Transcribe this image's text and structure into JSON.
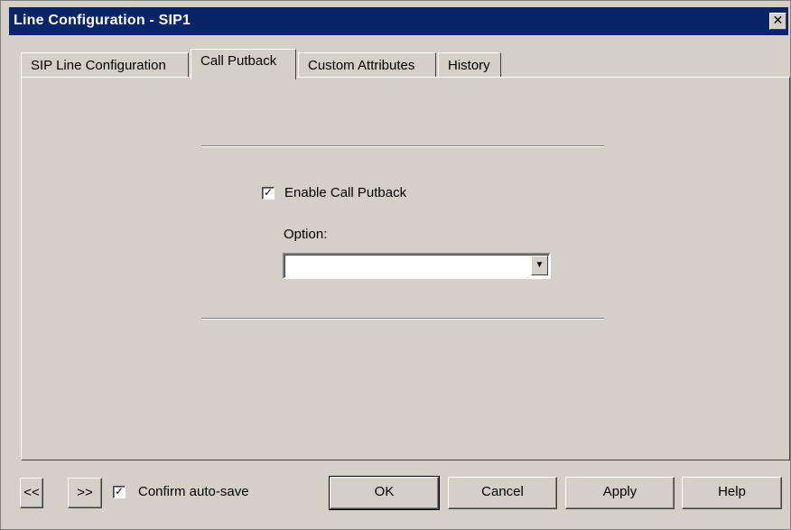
{
  "window": {
    "title": "Line Configuration - SIP1",
    "close_glyph": "✕"
  },
  "tabs": [
    {
      "label": "SIP Line Configuration",
      "active": false
    },
    {
      "label": "Call Putback",
      "active": true
    },
    {
      "label": "Custom Attributes",
      "active": false
    },
    {
      "label": "History",
      "active": false
    }
  ],
  "call_putback": {
    "enable_label": "Enable Call Putback",
    "enable_checked": true,
    "option_label": "Option:",
    "option_value": ""
  },
  "footer": {
    "prev_label": "<<",
    "next_label": ">>",
    "confirm_label": "Confirm auto-save",
    "confirm_checked": true,
    "ok_label": "OK",
    "cancel_label": "Cancel",
    "apply_label": "Apply",
    "help_label": "Help"
  },
  "icons": {
    "check": "✓",
    "dropdown_arrow": "▼"
  },
  "colors": {
    "titlebar": "#0a246a",
    "face": "#d4d0c8"
  }
}
